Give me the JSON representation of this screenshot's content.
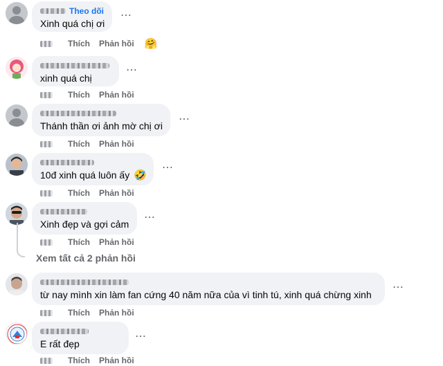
{
  "labels": {
    "like": "Thích",
    "reply": "Phản hồi"
  },
  "comments": [
    {
      "follow": "Theo dõi",
      "text": "Xinh quá chị ơi",
      "reaction_emoji": "🤗"
    },
    {
      "text": "xinh quá chị"
    },
    {
      "text": "Thánh thần ơi ảnh mờ chị ơi"
    },
    {
      "text": "10đ xinh quá luôn ấy",
      "inline_emoji": "🤣"
    },
    {
      "text": "Xinh đẹp và gợi cảm"
    },
    {
      "text": "từ nay mình xin làm fan cứng 40 năm nữa của vì tinh tú, xinh quá chừng xinh"
    },
    {
      "text": "E rất đẹp"
    }
  ],
  "view_replies": "Xem tất cả 2 phản hồi",
  "more_icon": "⋯"
}
